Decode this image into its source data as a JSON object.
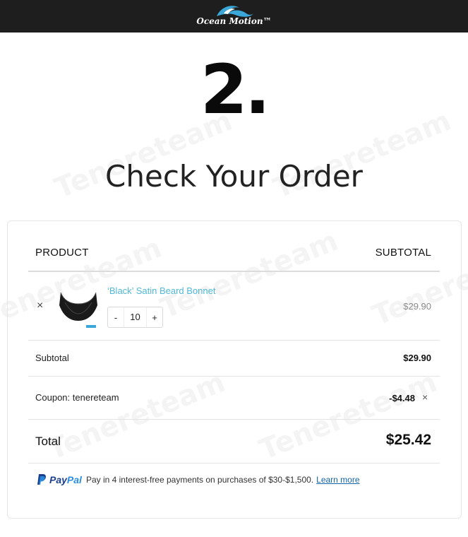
{
  "header": {
    "logo_text": "Ocean Motion™"
  },
  "watermark": {
    "text": "Tenereteam"
  },
  "page": {
    "step_number": "2.",
    "title": "Check Your Order"
  },
  "table": {
    "col_product": "PRODUCT",
    "col_subtotal": "SUBTOTAL"
  },
  "cart_item": {
    "remove_icon": "×",
    "name": "‘Black’ Satin Beard Bonnet",
    "qty_minus": "-",
    "quantity": "10",
    "qty_plus": "+",
    "line_subtotal": "$29.90"
  },
  "summary": {
    "subtotal_label": "Subtotal",
    "subtotal_value": "$29.90",
    "coupon_label": "Coupon: tenereteam",
    "coupon_value": "-$4.48",
    "coupon_remove_icon": "×",
    "total_label": "Total",
    "total_value": "$25.42"
  },
  "paypal": {
    "brand_pay": "Pay",
    "brand_pal": "Pal",
    "message": "Pay in 4 interest-free payments on purchases of $30-$1,500.",
    "learn_more": "Learn more"
  },
  "colors": {
    "topbar": "#1e1e1e",
    "link": "#4fb8d8",
    "paypal_dark": "#1b3f8f",
    "paypal_light": "#2a8ee0"
  },
  "icons": {
    "logo": "wave-logo-icon",
    "remove": "close-icon",
    "paypal": "paypal-icon"
  }
}
